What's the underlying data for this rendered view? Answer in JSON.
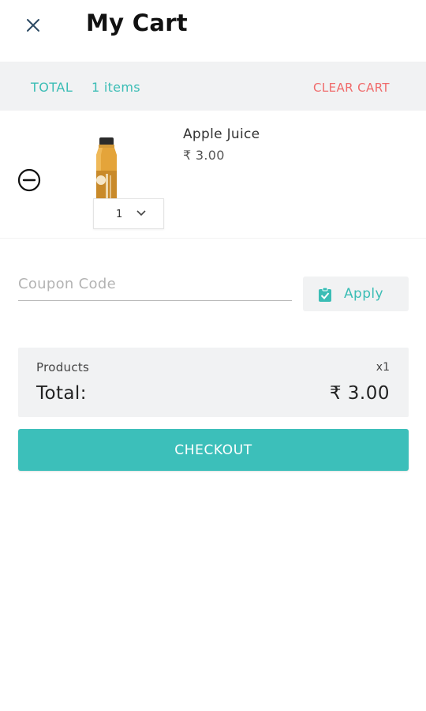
{
  "header": {
    "title": "My Cart",
    "close_icon": "close-icon"
  },
  "summary": {
    "total_label": "TOTAL",
    "items_count": "1 items",
    "clear_cart_label": "CLEAR CART"
  },
  "cart": {
    "items": [
      {
        "name": "Apple Juice",
        "price": "₹ 3.00",
        "quantity": "1",
        "image_icon": "juice-bottle-image",
        "remove_icon": "remove-circle-icon",
        "qty_icon": "chevron-down-icon"
      }
    ]
  },
  "coupon": {
    "placeholder": "Coupon Code",
    "value": "",
    "apply_label": "Apply",
    "apply_icon": "clipboard-check-icon"
  },
  "totals": {
    "products_label": "Products",
    "products_count": "x1",
    "total_label": "Total:",
    "total_value": "₹ 3.00"
  },
  "checkout": {
    "label": "CHECKOUT"
  },
  "colors": {
    "accent": "#3cbfba",
    "danger": "#f06a6a",
    "panel_bg": "#f1f2f3"
  }
}
